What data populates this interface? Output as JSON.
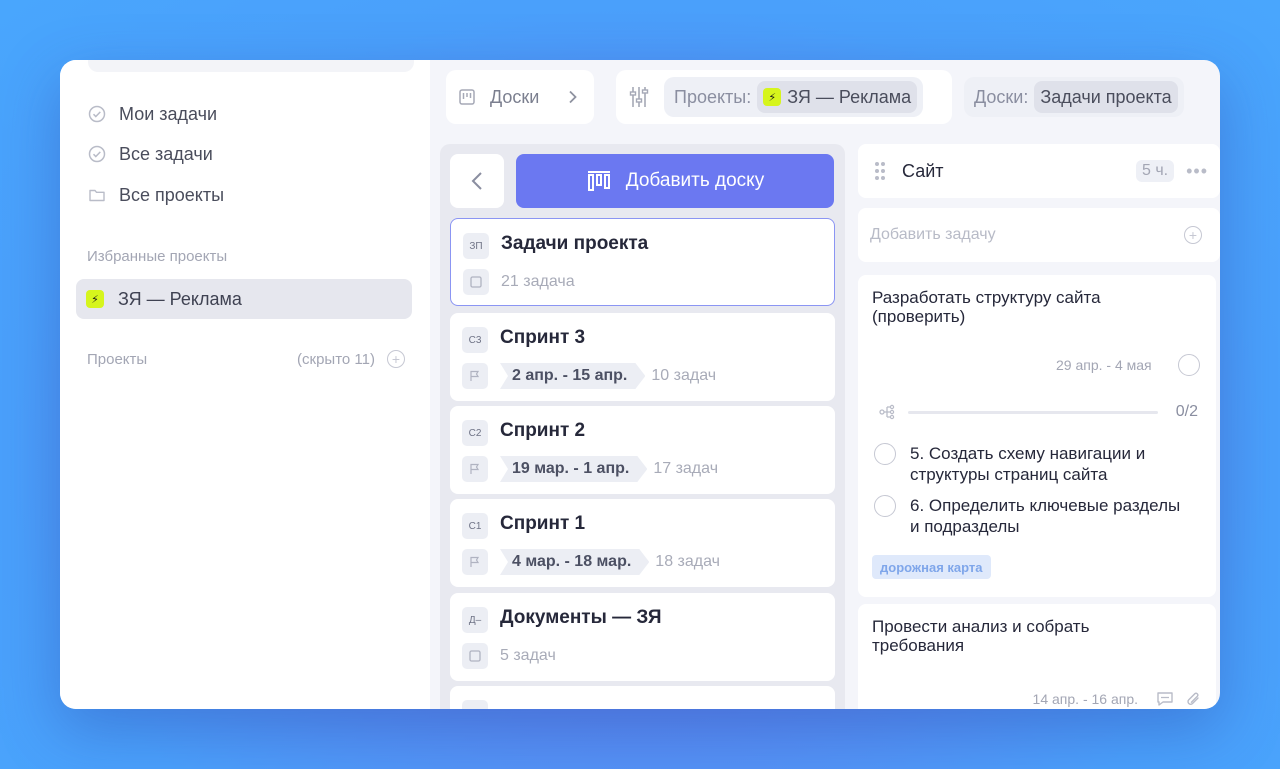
{
  "sidebar": {
    "nav": [
      {
        "label": "Мои задачи",
        "icon": "check-circle-icon"
      },
      {
        "label": "Все задачи",
        "icon": "check-circle-icon"
      },
      {
        "label": "Все проекты",
        "icon": "folder-icon"
      }
    ],
    "favorites_title": "Избранные проекты",
    "favorite_project": {
      "label": "ЗЯ — Реклама",
      "logo_color": "#d6f51c"
    },
    "projects_title": "Проекты",
    "projects_hidden": "(скрыто 11)"
  },
  "topbar": {
    "boards_label": "Доски",
    "projects_filter_label": "Проекты:",
    "projects_filter_value": "ЗЯ — Реклама",
    "boards_filter_label": "Доски:",
    "boards_filter_value": "Задачи проекта"
  },
  "boards": {
    "add_button": "Добавить доску",
    "accent": "#6b78f1",
    "items": [
      {
        "badge": "ЗП",
        "title": "Задачи проекта",
        "dates": "",
        "count": "21 задача",
        "selected": true
      },
      {
        "badge": "С3",
        "title": "Спринт 3",
        "dates": "2 апр. - 15 апр.",
        "count": "10 задач"
      },
      {
        "badge": "С2",
        "title": "Спринт 2",
        "dates": "19 мар. - 1 апр.",
        "count": "17 задач"
      },
      {
        "badge": "С1",
        "title": "Спринт 1",
        "dates": "4 мар. - 18 мар.",
        "count": "18 задач"
      },
      {
        "badge": "Д–",
        "title": "Документы — ЗЯ",
        "dates": "",
        "count": "5 задач"
      }
    ]
  },
  "column": {
    "title": "Сайт",
    "hours": "5 ч.",
    "add_task_placeholder": "Добавить задачу",
    "tasks": [
      {
        "title": "Разработать структуру сайта (проверить)",
        "dates": "29 апр. - 4 мая",
        "progress": "0/2",
        "subtasks": [
          "5. Создать схему навигации и структуры страниц сайта",
          "6. Определить ключевые разделы и подразделы"
        ],
        "tag": "дорожная карта"
      },
      {
        "title": "Провести анализ и собрать требования",
        "dates": "14 апр. - 16 апр."
      }
    ]
  }
}
